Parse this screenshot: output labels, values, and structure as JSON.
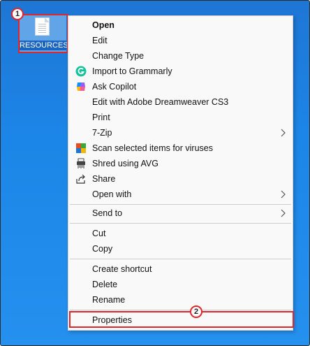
{
  "desktop": {
    "icon_label": "RESOURCES"
  },
  "badges": {
    "one": "1",
    "two": "2"
  },
  "menu": {
    "items": [
      {
        "label": "Open"
      },
      {
        "label": "Edit"
      },
      {
        "label": "Change Type"
      },
      {
        "label": "Import to Grammarly"
      },
      {
        "label": "Ask Copilot"
      },
      {
        "label": "Edit with Adobe Dreamweaver CS3"
      },
      {
        "label": "Print"
      },
      {
        "label": "7-Zip"
      },
      {
        "label": "Scan selected items for viruses"
      },
      {
        "label": "Shred using AVG"
      },
      {
        "label": "Share"
      },
      {
        "label": "Open with"
      },
      {
        "label": "Send to"
      },
      {
        "label": "Cut"
      },
      {
        "label": "Copy"
      },
      {
        "label": "Create shortcut"
      },
      {
        "label": "Delete"
      },
      {
        "label": "Rename"
      },
      {
        "label": "Properties"
      }
    ]
  },
  "colors": {
    "highlight": "#e0252b",
    "desktop": "#1c86e8",
    "menu_bg": "#f9f9f9",
    "grammarly": "#15c39a"
  }
}
